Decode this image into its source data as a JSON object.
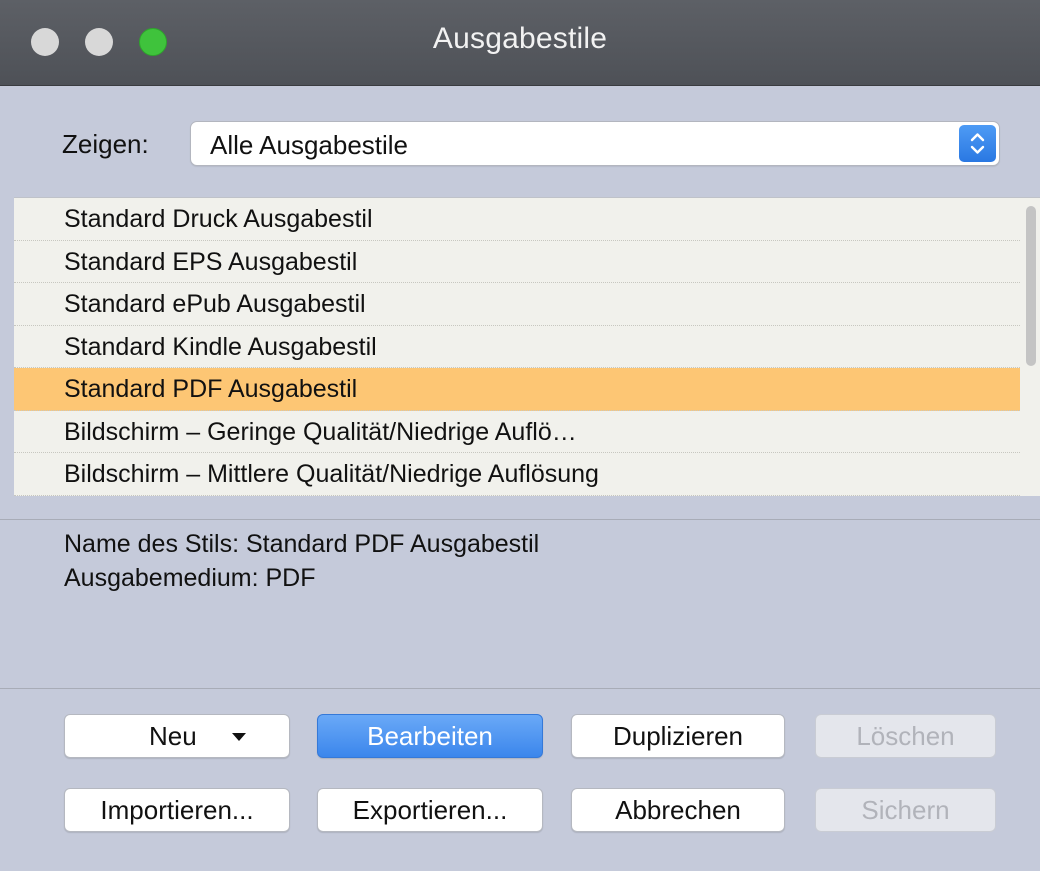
{
  "window": {
    "title": "Ausgabestile",
    "traffic_lights": [
      "close",
      "minimize",
      "zoom"
    ]
  },
  "filter": {
    "label": "Zeigen:",
    "selected": "Alle Ausgabestile"
  },
  "list": {
    "items": [
      "Standard Druck Ausgabestil",
      "Standard EPS Ausgabestil",
      "Standard ePub Ausgabestil",
      "Standard Kindle Ausgabestil",
      "Standard PDF Ausgabestil",
      "Bildschirm – Geringe Qualität/Niedrige Auflö…",
      "Bildschirm – Mittlere Qualität/Niedrige Auflösung"
    ],
    "selected_index": 4
  },
  "details": {
    "name_line": "Name des Stils: Standard PDF Ausgabestil",
    "medium_line": "Ausgabemedium: PDF"
  },
  "buttons": {
    "neu": "Neu",
    "bearbeiten": "Bearbeiten",
    "duplizieren": "Duplizieren",
    "loeschen": "Löschen",
    "importieren": "Importieren...",
    "exportieren": "Exportieren...",
    "abbrechen": "Abbrechen",
    "sichern": "Sichern"
  },
  "colors": {
    "selection": "#fdc674",
    "primary_button": "#3b86ec",
    "window_background": "#c5cada"
  }
}
